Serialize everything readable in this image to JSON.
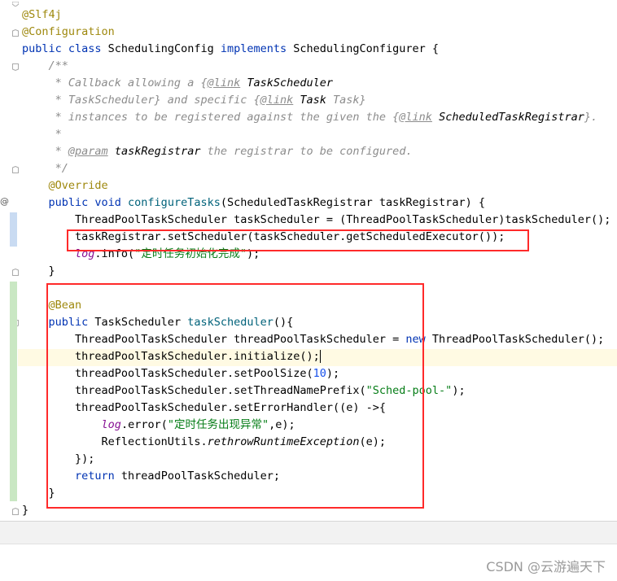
{
  "editor": {
    "code_lines": [
      {
        "segments": [
          {
            "t": "@Slf4j",
            "c": "ann"
          }
        ]
      },
      {
        "segments": [
          {
            "t": "@Configuration",
            "c": "ann"
          }
        ]
      },
      {
        "segments": [
          {
            "t": "public class ",
            "c": "kw"
          },
          {
            "t": "SchedulingConfig "
          },
          {
            "t": "implements ",
            "c": "kw"
          },
          {
            "t": "SchedulingConfigurer {"
          }
        ]
      },
      {
        "segments": [
          {
            "t": "    /**",
            "c": "cmt"
          }
        ]
      },
      {
        "segments": [
          {
            "t": "     * Callback allowing a ",
            "c": "cmt"
          },
          {
            "t": "{",
            "c": "cmt"
          },
          {
            "t": "@link",
            "c": "tag"
          },
          {
            "t": " TaskScheduler",
            "c": "ref"
          }
        ]
      },
      {
        "segments": [
          {
            "t": "     * TaskScheduler} and specific ",
            "c": "cmt"
          },
          {
            "t": "{",
            "c": "cmt"
          },
          {
            "t": "@link",
            "c": "tag"
          },
          {
            "t": " Task",
            "c": "ref"
          },
          {
            "t": " Task}",
            "c": "cmt"
          }
        ]
      },
      {
        "segments": [
          {
            "t": "     * instances to be registered against the given the ",
            "c": "cmt"
          },
          {
            "t": "{",
            "c": "cmt"
          },
          {
            "t": "@link",
            "c": "tag"
          },
          {
            "t": " ScheduledTaskRegistrar",
            "c": "ref"
          },
          {
            "t": "}.",
            "c": "cmt"
          }
        ]
      },
      {
        "segments": [
          {
            "t": "     *",
            "c": "cmt"
          }
        ]
      },
      {
        "segments": [
          {
            "t": "     * ",
            "c": "cmt"
          },
          {
            "t": "@param",
            "c": "tag"
          },
          {
            "t": " taskRegistrar",
            "c": "ref"
          },
          {
            "t": " the registrar to be configured.",
            "c": "cmt"
          }
        ]
      },
      {
        "segments": [
          {
            "t": "     */",
            "c": "cmt"
          }
        ]
      },
      {
        "segments": [
          {
            "t": "    @Override",
            "c": "ann"
          }
        ]
      },
      {
        "segments": [
          {
            "t": "    public void ",
            "c": "kw"
          },
          {
            "t": "configureTasks",
            "c": "fn"
          },
          {
            "t": "(ScheduledTaskRegistrar taskRegistrar) {"
          }
        ]
      },
      {
        "segments": [
          {
            "t": "        ThreadPoolTaskScheduler taskScheduler = (ThreadPoolTaskScheduler)taskScheduler();"
          }
        ]
      },
      {
        "segments": [
          {
            "t": "        taskRegistrar.setScheduler(taskScheduler.getScheduledExecutor());"
          }
        ]
      },
      {
        "segments": [
          {
            "t": "        "
          },
          {
            "t": "log",
            "c": "fld"
          },
          {
            "t": ".info("
          },
          {
            "t": "\"定时任务初始化完成\"",
            "c": "str"
          },
          {
            "t": ");"
          }
        ]
      },
      {
        "segments": [
          {
            "t": "    }"
          }
        ]
      },
      {
        "segments": [
          {
            "t": ""
          }
        ]
      },
      {
        "segments": [
          {
            "t": "    @Bean",
            "c": "ann"
          }
        ]
      },
      {
        "segments": [
          {
            "t": "    public ",
            "c": "kw"
          },
          {
            "t": "TaskScheduler "
          },
          {
            "t": "taskScheduler",
            "c": "fn"
          },
          {
            "t": "(){"
          }
        ]
      },
      {
        "segments": [
          {
            "t": "        ThreadPoolTaskScheduler threadPoolTaskScheduler = "
          },
          {
            "t": "new ",
            "c": "kw"
          },
          {
            "t": "ThreadPoolTaskScheduler();"
          }
        ]
      },
      {
        "segments": [
          {
            "t": "        threadPoolTaskScheduler.initialize();"
          }
        ]
      },
      {
        "segments": [
          {
            "t": "        threadPoolTaskScheduler.setPoolSize("
          },
          {
            "t": "10",
            "c": "num"
          },
          {
            "t": ");"
          }
        ]
      },
      {
        "segments": [
          {
            "t": "        threadPoolTaskScheduler.setThreadNamePrefix("
          },
          {
            "t": "\"Sched-pool-\"",
            "c": "str"
          },
          {
            "t": ");"
          }
        ]
      },
      {
        "segments": [
          {
            "t": "        threadPoolTaskScheduler.setErrorHandler((e) ->{"
          }
        ]
      },
      {
        "segments": [
          {
            "t": "            "
          },
          {
            "t": "log",
            "c": "fld"
          },
          {
            "t": ".error("
          },
          {
            "t": "\"定时任务出现异常\"",
            "c": "str"
          },
          {
            "t": ",e);"
          }
        ]
      },
      {
        "segments": [
          {
            "t": "            ReflectionUtils."
          },
          {
            "t": "rethrowRuntimeException",
            "c": "it"
          },
          {
            "t": "(e);"
          }
        ]
      },
      {
        "segments": [
          {
            "t": "        });"
          }
        ]
      },
      {
        "segments": [
          {
            "t": "        return ",
            "c": "kw"
          },
          {
            "t": "threadPoolTaskScheduler;"
          }
        ]
      },
      {
        "segments": [
          {
            "t": "    }"
          }
        ]
      },
      {
        "segments": [
          {
            "t": "}"
          }
        ]
      }
    ]
  },
  "gutter": {
    "fold_icons": [
      "fold-marker",
      "fold-marker",
      "fold-marker",
      "fold-marker",
      "fold-marker",
      "fold-marker",
      "fold-marker"
    ],
    "override_icon": "@",
    "change_marker_colors": {
      "modified": "#c9dbf2",
      "added": "#c9e7c3"
    }
  },
  "highlight_color": "#ff2a2a",
  "watermark": "CSDN @云游遍天下"
}
